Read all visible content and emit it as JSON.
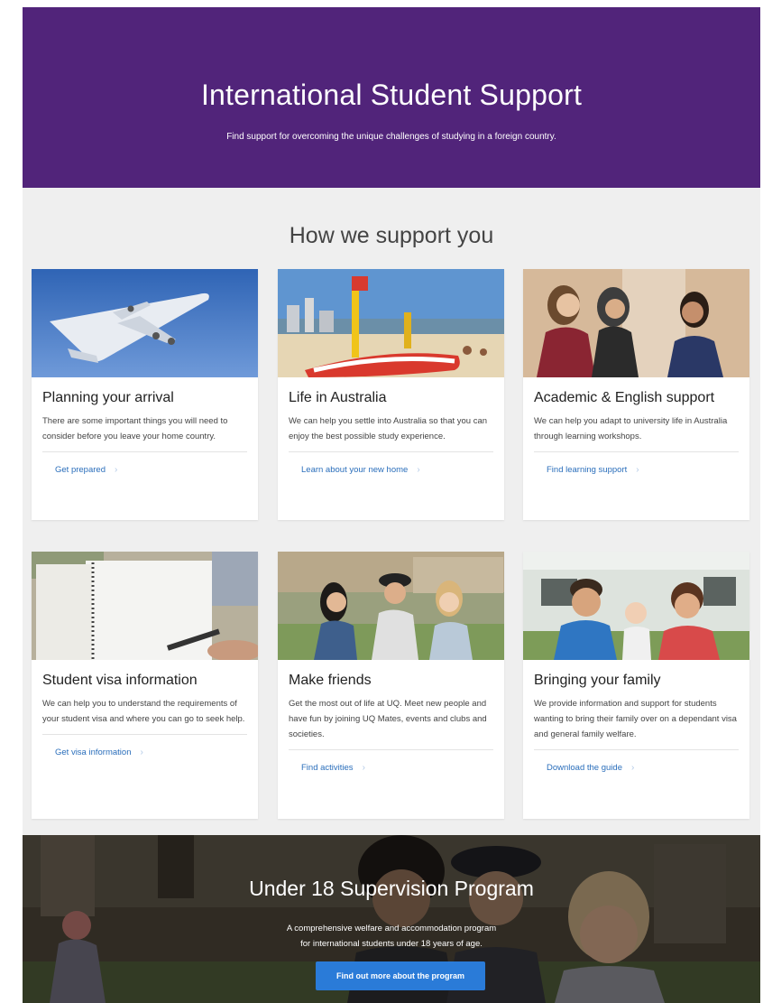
{
  "hero": {
    "title": "International Student Support",
    "subtitle": "Find support for overcoming the unique challenges of studying in a foreign country.",
    "background_color": "#51247a"
  },
  "support": {
    "heading": "How we support you",
    "cards": [
      {
        "title": "Planning your arrival",
        "description": "There are some important things you will need to consider before you leave your home country.",
        "link": "Get prepared",
        "image": "airplane-photo"
      },
      {
        "title": "Life in Australia",
        "description": "We can help you settle into Australia so that you can enjoy the best possible study experience.",
        "link": "Learn about your new home",
        "image": "beach-photo"
      },
      {
        "title": "Academic & English support",
        "description": "We can help you adapt to university life in Australia through learning workshops.",
        "link": "Find learning support",
        "image": "students-talking-photo"
      },
      {
        "title": "Student visa information",
        "description": "We can help you to understand the requirements of your student visa and where you can go to seek help.",
        "link": "Get visa information",
        "image": "notebook-photo"
      },
      {
        "title": "Make friends",
        "description": "Get the most out of life at UQ. Meet new people and have fun by joining UQ Mates, events and clubs and societies.",
        "link": "Find activities",
        "image": "friends-photo"
      },
      {
        "title": "Bringing your family",
        "description": "We provide information and support for students wanting to bring their family over on a dependant visa and general family welfare.",
        "link": "Download the guide",
        "image": "family-photo"
      }
    ],
    "link_chevron": "›"
  },
  "u18": {
    "title": "Under 18 Supervision Program",
    "line1": "A comprehensive welfare and accommodation program",
    "line2": "for international students under 18 years of age.",
    "button": "Find out more about the program",
    "button_color": "#2a7bd8"
  }
}
